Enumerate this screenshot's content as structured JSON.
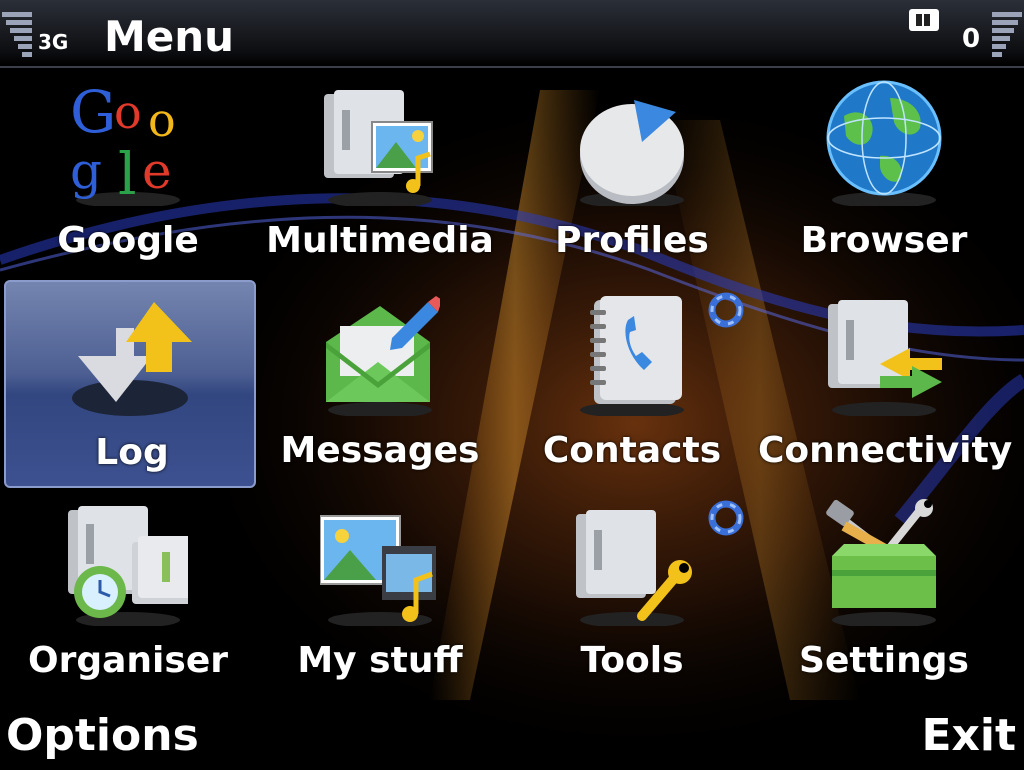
{
  "status_bar": {
    "network_type": "3G",
    "title": "Menu",
    "unread_count": "0"
  },
  "menu_items": [
    {
      "label": "Google"
    },
    {
      "label": "Multimedia"
    },
    {
      "label": "Profiles"
    },
    {
      "label": "Browser"
    },
    {
      "label": "Log"
    },
    {
      "label": "Messages"
    },
    {
      "label": "Contacts"
    },
    {
      "label": "Connectivity"
    },
    {
      "label": "Organiser"
    },
    {
      "label": "My stuff"
    },
    {
      "label": "Tools"
    },
    {
      "label": "Settings"
    }
  ],
  "selected_item": "Log",
  "softkeys": {
    "left": "Options",
    "right": "Exit"
  },
  "colors": {
    "selection": "#3d5191",
    "background": "#000000",
    "text": "#ffffff",
    "busy_indicator": "#3a6fd8"
  }
}
